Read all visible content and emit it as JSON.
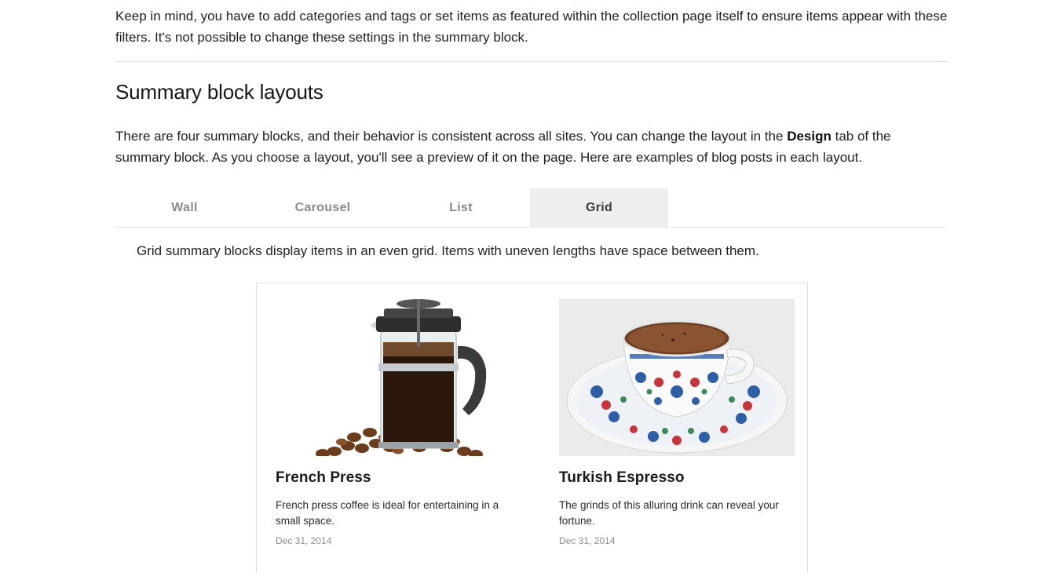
{
  "intro": {
    "text": "Keep in mind, you have to add categories and tags or set items as featured within the collection page itself to ensure items appear with these filters. It's not possible to change these settings in the summary block."
  },
  "section": {
    "heading": "Summary block layouts",
    "para_part1": "There are four summary blocks, and their behavior is consistent across all sites. You can change the layout in the ",
    "para_bold": "Design",
    "para_part2": " tab of the summary block. As you choose a layout, you'll see a preview of it on the page. Here are examples of blog posts in each layout."
  },
  "tabs": [
    {
      "label": "Wall"
    },
    {
      "label": "Carousel"
    },
    {
      "label": "List"
    },
    {
      "label": "Grid"
    }
  ],
  "active_tab": "Grid",
  "tab_description": "Grid summary blocks display items in an even grid. Items with uneven lengths have space between them.",
  "items": [
    {
      "image": "french-press-photo",
      "title": "French Press",
      "excerpt": "French press coffee is ideal for entertaining in a small space.",
      "date": "Dec 31, 2014"
    },
    {
      "image": "turkish-coffee-cup-photo",
      "title": "Turkish Espresso",
      "excerpt": "The grinds of this alluring drink can reveal your fortune.",
      "date": "Dec 31, 2014"
    }
  ],
  "colors": {
    "active_tab_bg": "#efeeec",
    "inactive_tab_text": "#8a8a8a",
    "date_text": "#8b8b8b"
  }
}
